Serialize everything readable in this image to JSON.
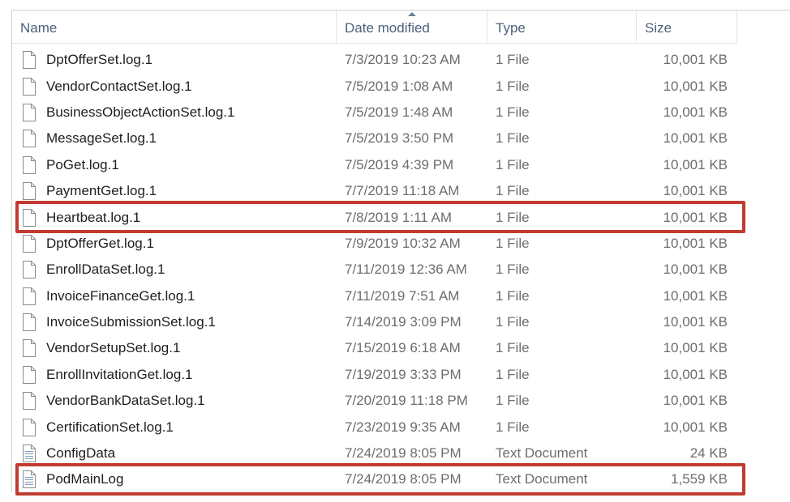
{
  "columns": {
    "name": "Name",
    "date": "Date modified",
    "type": "Type",
    "size": "Size"
  },
  "sort": {
    "column": "date",
    "direction": "ascending"
  },
  "highlight_color": "#c23b32",
  "files": [
    {
      "name": "DptOfferSet.log.1",
      "date": "7/3/2019 10:23 AM",
      "type": "1 File",
      "size": "10,001 KB",
      "icon": "generic-file-icon",
      "highlighted": false
    },
    {
      "name": "VendorContactSet.log.1",
      "date": "7/5/2019 1:08 AM",
      "type": "1 File",
      "size": "10,001 KB",
      "icon": "generic-file-icon",
      "highlighted": false
    },
    {
      "name": "BusinessObjectActionSet.log.1",
      "date": "7/5/2019 1:48 AM",
      "type": "1 File",
      "size": "10,001 KB",
      "icon": "generic-file-icon",
      "highlighted": false
    },
    {
      "name": "MessageSet.log.1",
      "date": "7/5/2019 3:50 PM",
      "type": "1 File",
      "size": "10,001 KB",
      "icon": "generic-file-icon",
      "highlighted": false
    },
    {
      "name": "PoGet.log.1",
      "date": "7/5/2019 4:39 PM",
      "type": "1 File",
      "size": "10,001 KB",
      "icon": "generic-file-icon",
      "highlighted": false
    },
    {
      "name": "PaymentGet.log.1",
      "date": "7/7/2019 11:18 AM",
      "type": "1 File",
      "size": "10,001 KB",
      "icon": "generic-file-icon",
      "highlighted": false
    },
    {
      "name": "Heartbeat.log.1",
      "date": "7/8/2019 1:11 AM",
      "type": "1 File",
      "size": "10,001 KB",
      "icon": "generic-file-icon",
      "highlighted": true
    },
    {
      "name": "DptOfferGet.log.1",
      "date": "7/9/2019 10:32 AM",
      "type": "1 File",
      "size": "10,001 KB",
      "icon": "generic-file-icon",
      "highlighted": false
    },
    {
      "name": "EnrollDataSet.log.1",
      "date": "7/11/2019 12:36 AM",
      "type": "1 File",
      "size": "10,001 KB",
      "icon": "generic-file-icon",
      "highlighted": false
    },
    {
      "name": "InvoiceFinanceGet.log.1",
      "date": "7/11/2019 7:51 AM",
      "type": "1 File",
      "size": "10,001 KB",
      "icon": "generic-file-icon",
      "highlighted": false
    },
    {
      "name": "InvoiceSubmissionSet.log.1",
      "date": "7/14/2019 3:09 PM",
      "type": "1 File",
      "size": "10,001 KB",
      "icon": "generic-file-icon",
      "highlighted": false
    },
    {
      "name": "VendorSetupSet.log.1",
      "date": "7/15/2019 6:18 AM",
      "type": "1 File",
      "size": "10,001 KB",
      "icon": "generic-file-icon",
      "highlighted": false
    },
    {
      "name": "EnrollInvitationGet.log.1",
      "date": "7/19/2019 3:33 PM",
      "type": "1 File",
      "size": "10,001 KB",
      "icon": "generic-file-icon",
      "highlighted": false
    },
    {
      "name": "VendorBankDataSet.log.1",
      "date": "7/20/2019 11:18 PM",
      "type": "1 File",
      "size": "10,001 KB",
      "icon": "generic-file-icon",
      "highlighted": false
    },
    {
      "name": "CertificationSet.log.1",
      "date": "7/23/2019 9:35 AM",
      "type": "1 File",
      "size": "10,001 KB",
      "icon": "generic-file-icon",
      "highlighted": false
    },
    {
      "name": "ConfigData",
      "date": "7/24/2019 8:05 PM",
      "type": "Text Document",
      "size": "24 KB",
      "icon": "text-document-icon",
      "highlighted": false
    },
    {
      "name": "PodMainLog",
      "date": "7/24/2019 8:05 PM",
      "type": "Text Document",
      "size": "1,559 KB",
      "icon": "text-document-icon",
      "highlighted": true
    }
  ]
}
